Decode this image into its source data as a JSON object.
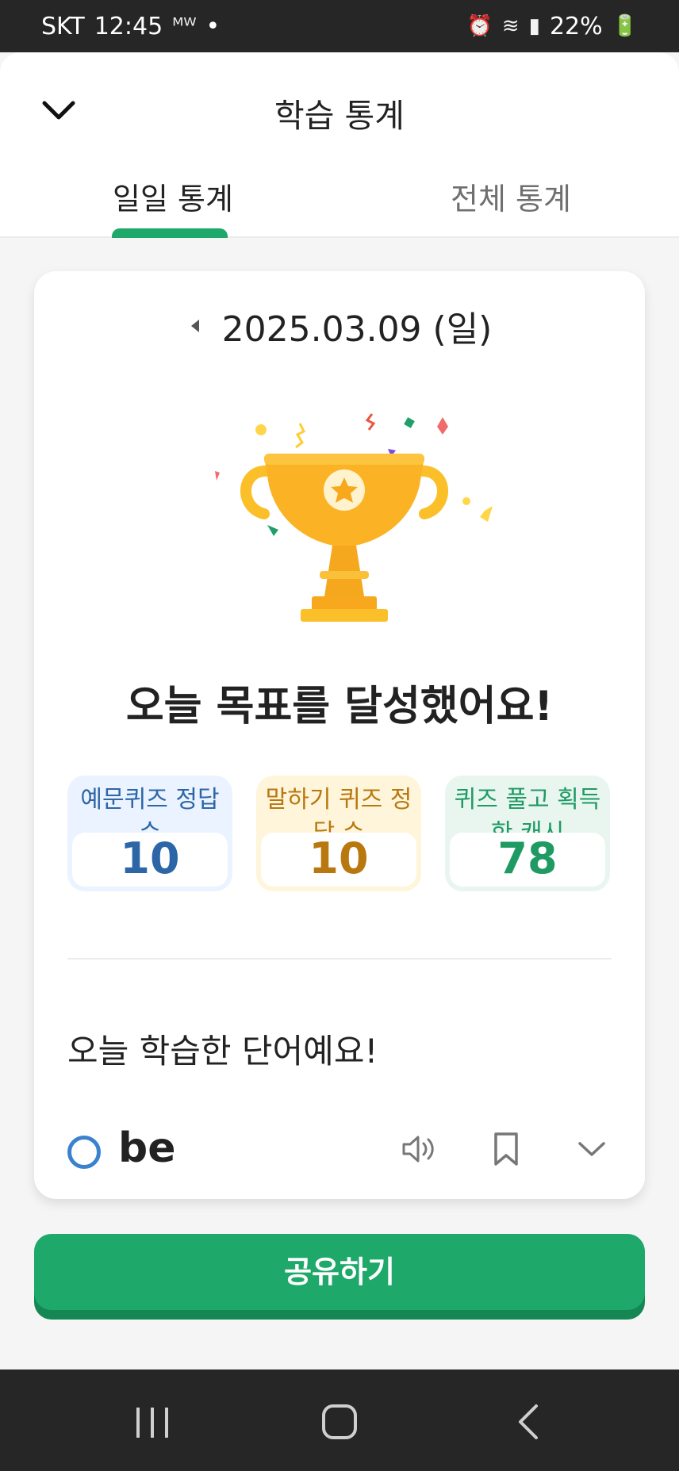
{
  "status_bar": {
    "carrier": "SKT",
    "time": "12:45",
    "extra_icons": "ᴹᵂ",
    "battery": "22%"
  },
  "header": {
    "title": "학습 통계",
    "back_icon": "chevron-down-icon"
  },
  "tabs": [
    {
      "label": "일일 통계",
      "active": true
    },
    {
      "label": "전체 통계",
      "active": false
    }
  ],
  "card": {
    "date": "2025.03.09 (일)",
    "goal_message": "오늘 목표를 달성했어요!",
    "stats": [
      {
        "label": "예문퀴즈 정답 수",
        "value": "10",
        "color": "#2d66a6"
      },
      {
        "label": "말하기 퀴즈 정답 수",
        "value": "10",
        "color": "#b9780f"
      },
      {
        "label": "퀴즈 풀고 획득한 캐시",
        "value": "78",
        "color": "#1f9a63"
      }
    ],
    "words_title": "오늘 학습한 단어예요!",
    "word": {
      "text": "be",
      "icons": [
        "speaker-icon",
        "bookmark-icon",
        "chevron-down-icon"
      ]
    }
  },
  "share_button": {
    "label": "공유하기",
    "color": "#1ea86a"
  },
  "nav_bar": {
    "icons": [
      "recent-apps-icon",
      "home-icon",
      "back-icon"
    ]
  }
}
